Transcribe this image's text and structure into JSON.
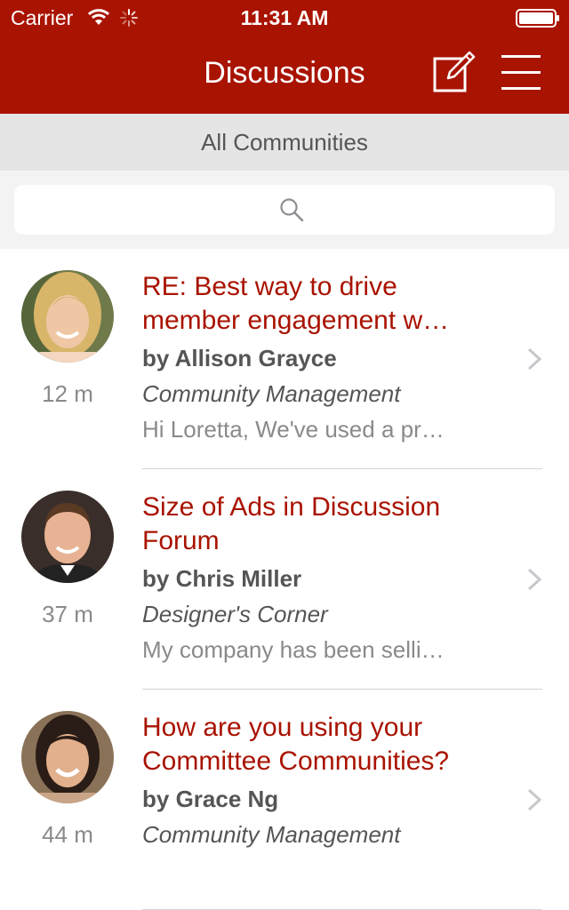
{
  "status_bar": {
    "carrier": "Carrier",
    "time": "11:31 AM"
  },
  "nav": {
    "title": "Discussions",
    "compose_icon": "compose-icon",
    "menu_icon": "hamburger-menu-icon"
  },
  "filter": {
    "label": "All Communities"
  },
  "search": {
    "placeholder": "",
    "value": ""
  },
  "colors": {
    "brand": "#a91301",
    "subject": "#a91301",
    "filter_bg": "#e5e5e5"
  },
  "discussions": [
    {
      "subject": "RE: Best way to drive member engagement w…",
      "author": "by Allison Grayce",
      "community": "Community Management",
      "preview": "Hi Loretta, We've used a pr…",
      "age": "12 m"
    },
    {
      "subject": "Size of Ads in Discussion Forum",
      "author": "by Chris Miller",
      "community": "Designer's Corner",
      "preview": "My company has been selli…",
      "age": "37 m"
    },
    {
      "subject": "How are you using your Committee Communities?",
      "author": "by Grace Ng",
      "community": "Community Management",
      "preview": "",
      "age": "44 m"
    }
  ]
}
